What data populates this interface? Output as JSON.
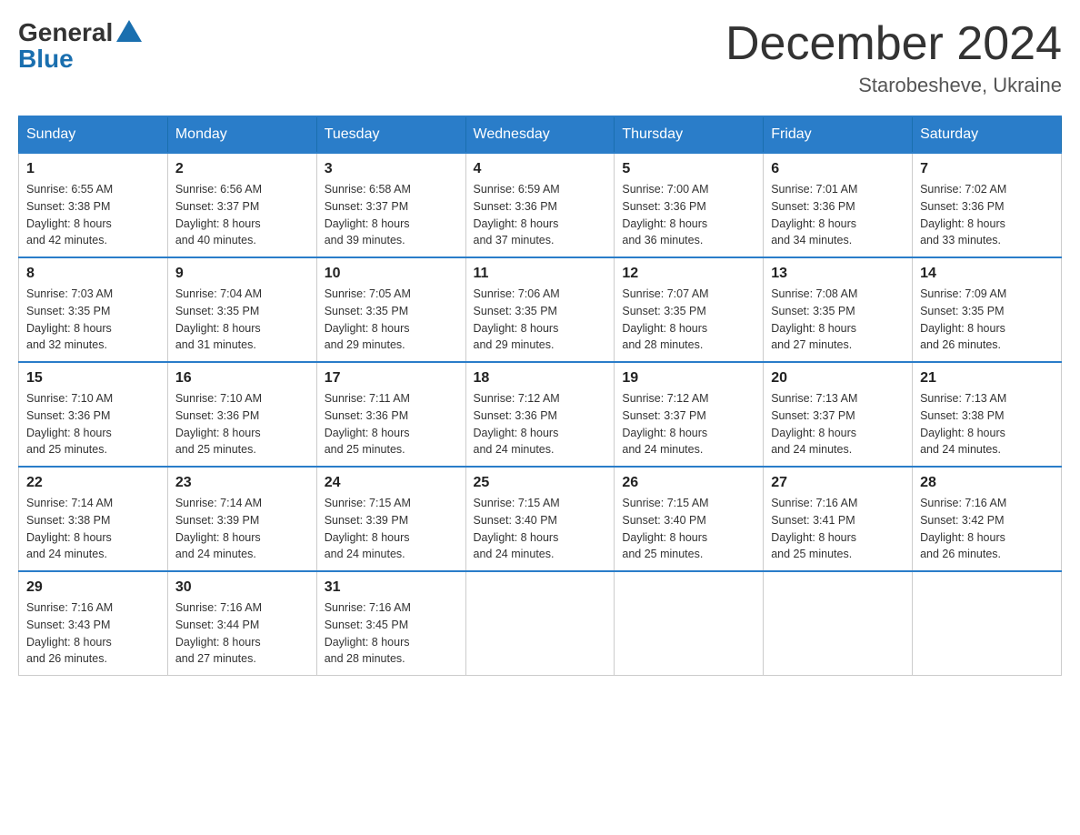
{
  "logo": {
    "general": "General",
    "blue": "Blue"
  },
  "title": "December 2024",
  "location": "Starobesheve, Ukraine",
  "headers": [
    "Sunday",
    "Monday",
    "Tuesday",
    "Wednesday",
    "Thursday",
    "Friday",
    "Saturday"
  ],
  "weeks": [
    [
      {
        "day": "1",
        "sunrise": "6:55 AM",
        "sunset": "3:38 PM",
        "daylight": "8 hours and 42 minutes."
      },
      {
        "day": "2",
        "sunrise": "6:56 AM",
        "sunset": "3:37 PM",
        "daylight": "8 hours and 40 minutes."
      },
      {
        "day": "3",
        "sunrise": "6:58 AM",
        "sunset": "3:37 PM",
        "daylight": "8 hours and 39 minutes."
      },
      {
        "day": "4",
        "sunrise": "6:59 AM",
        "sunset": "3:36 PM",
        "daylight": "8 hours and 37 minutes."
      },
      {
        "day": "5",
        "sunrise": "7:00 AM",
        "sunset": "3:36 PM",
        "daylight": "8 hours and 36 minutes."
      },
      {
        "day": "6",
        "sunrise": "7:01 AM",
        "sunset": "3:36 PM",
        "daylight": "8 hours and 34 minutes."
      },
      {
        "day": "7",
        "sunrise": "7:02 AM",
        "sunset": "3:36 PM",
        "daylight": "8 hours and 33 minutes."
      }
    ],
    [
      {
        "day": "8",
        "sunrise": "7:03 AM",
        "sunset": "3:35 PM",
        "daylight": "8 hours and 32 minutes."
      },
      {
        "day": "9",
        "sunrise": "7:04 AM",
        "sunset": "3:35 PM",
        "daylight": "8 hours and 31 minutes."
      },
      {
        "day": "10",
        "sunrise": "7:05 AM",
        "sunset": "3:35 PM",
        "daylight": "8 hours and 29 minutes."
      },
      {
        "day": "11",
        "sunrise": "7:06 AM",
        "sunset": "3:35 PM",
        "daylight": "8 hours and 29 minutes."
      },
      {
        "day": "12",
        "sunrise": "7:07 AM",
        "sunset": "3:35 PM",
        "daylight": "8 hours and 28 minutes."
      },
      {
        "day": "13",
        "sunrise": "7:08 AM",
        "sunset": "3:35 PM",
        "daylight": "8 hours and 27 minutes."
      },
      {
        "day": "14",
        "sunrise": "7:09 AM",
        "sunset": "3:35 PM",
        "daylight": "8 hours and 26 minutes."
      }
    ],
    [
      {
        "day": "15",
        "sunrise": "7:10 AM",
        "sunset": "3:36 PM",
        "daylight": "8 hours and 25 minutes."
      },
      {
        "day": "16",
        "sunrise": "7:10 AM",
        "sunset": "3:36 PM",
        "daylight": "8 hours and 25 minutes."
      },
      {
        "day": "17",
        "sunrise": "7:11 AM",
        "sunset": "3:36 PM",
        "daylight": "8 hours and 25 minutes."
      },
      {
        "day": "18",
        "sunrise": "7:12 AM",
        "sunset": "3:36 PM",
        "daylight": "8 hours and 24 minutes."
      },
      {
        "day": "19",
        "sunrise": "7:12 AM",
        "sunset": "3:37 PM",
        "daylight": "8 hours and 24 minutes."
      },
      {
        "day": "20",
        "sunrise": "7:13 AM",
        "sunset": "3:37 PM",
        "daylight": "8 hours and 24 minutes."
      },
      {
        "day": "21",
        "sunrise": "7:13 AM",
        "sunset": "3:38 PM",
        "daylight": "8 hours and 24 minutes."
      }
    ],
    [
      {
        "day": "22",
        "sunrise": "7:14 AM",
        "sunset": "3:38 PM",
        "daylight": "8 hours and 24 minutes."
      },
      {
        "day": "23",
        "sunrise": "7:14 AM",
        "sunset": "3:39 PM",
        "daylight": "8 hours and 24 minutes."
      },
      {
        "day": "24",
        "sunrise": "7:15 AM",
        "sunset": "3:39 PM",
        "daylight": "8 hours and 24 minutes."
      },
      {
        "day": "25",
        "sunrise": "7:15 AM",
        "sunset": "3:40 PM",
        "daylight": "8 hours and 24 minutes."
      },
      {
        "day": "26",
        "sunrise": "7:15 AM",
        "sunset": "3:40 PM",
        "daylight": "8 hours and 25 minutes."
      },
      {
        "day": "27",
        "sunrise": "7:16 AM",
        "sunset": "3:41 PM",
        "daylight": "8 hours and 25 minutes."
      },
      {
        "day": "28",
        "sunrise": "7:16 AM",
        "sunset": "3:42 PM",
        "daylight": "8 hours and 26 minutes."
      }
    ],
    [
      {
        "day": "29",
        "sunrise": "7:16 AM",
        "sunset": "3:43 PM",
        "daylight": "8 hours and 26 minutes."
      },
      {
        "day": "30",
        "sunrise": "7:16 AM",
        "sunset": "3:44 PM",
        "daylight": "8 hours and 27 minutes."
      },
      {
        "day": "31",
        "sunrise": "7:16 AM",
        "sunset": "3:45 PM",
        "daylight": "8 hours and 28 minutes."
      },
      null,
      null,
      null,
      null
    ]
  ],
  "labels": {
    "sunrise": "Sunrise: ",
    "sunset": "Sunset: ",
    "daylight": "Daylight: "
  }
}
